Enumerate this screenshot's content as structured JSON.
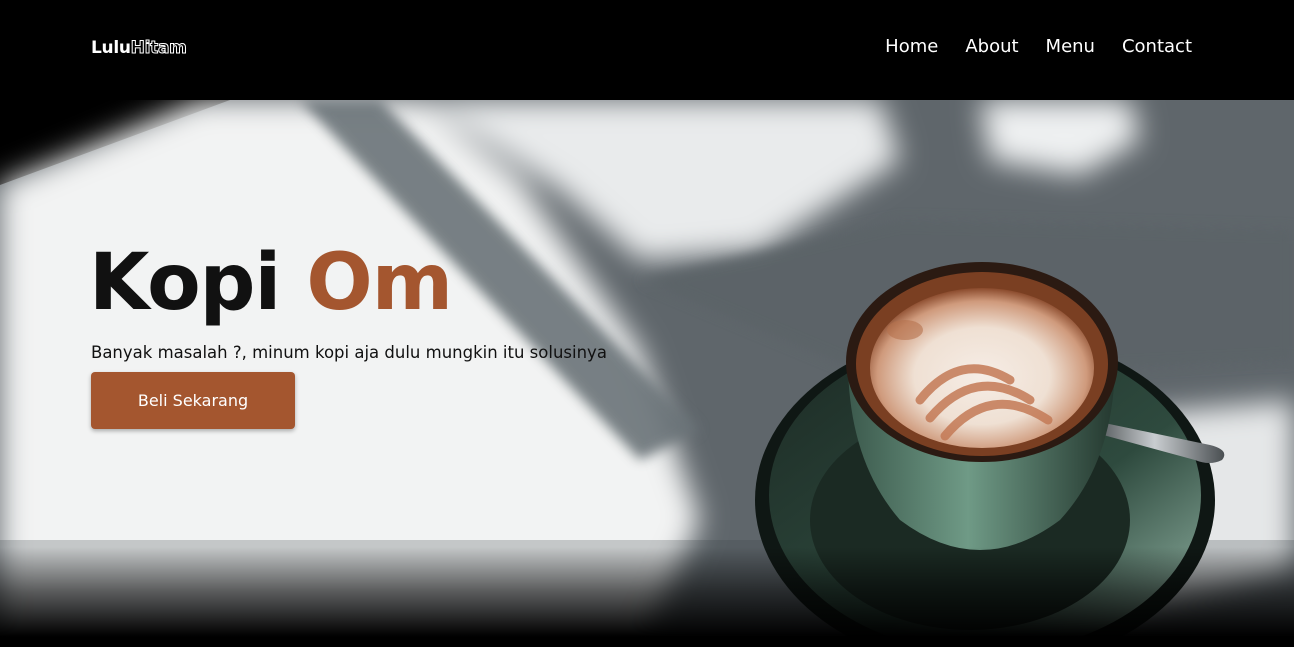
{
  "navbar": {
    "logo": {
      "part1": "Lulu",
      "part2": "Hitam"
    },
    "links": [
      "Home",
      "About",
      "Menu",
      "Contact"
    ]
  },
  "hero": {
    "title_part1": "Kopi",
    "title_part2": "Om",
    "subtitle": "Banyak masalah ?, minum kopi aja dulu mungkin itu solusinya",
    "cta_label": "Beli Sekarang",
    "background_image": "coffee-cup-photo"
  },
  "colors": {
    "accent": "#a4562f",
    "nav_bg": "#000000",
    "text_dark": "#111111"
  }
}
